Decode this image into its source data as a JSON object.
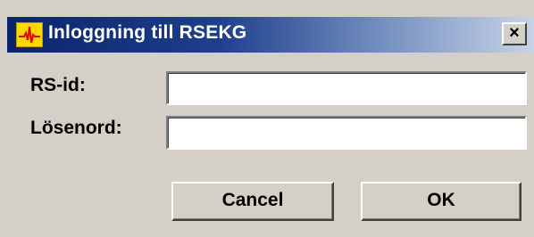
{
  "dialog": {
    "title": "Inloggning till RSEKG",
    "icon": "ecg-heartbeat-icon",
    "close_symbol": "×"
  },
  "form": {
    "rsid_label": "RS-id:",
    "rsid_value": "",
    "password_label": "Lösenord:",
    "password_value": ""
  },
  "buttons": {
    "cancel_label": "Cancel",
    "ok_label": "OK"
  },
  "colors": {
    "titlebar_start": "#0a246a",
    "titlebar_end": "#c8d3e6",
    "window_bg": "#d4d0c8",
    "icon_bg": "#ffd800",
    "icon_line": "#e00000"
  }
}
